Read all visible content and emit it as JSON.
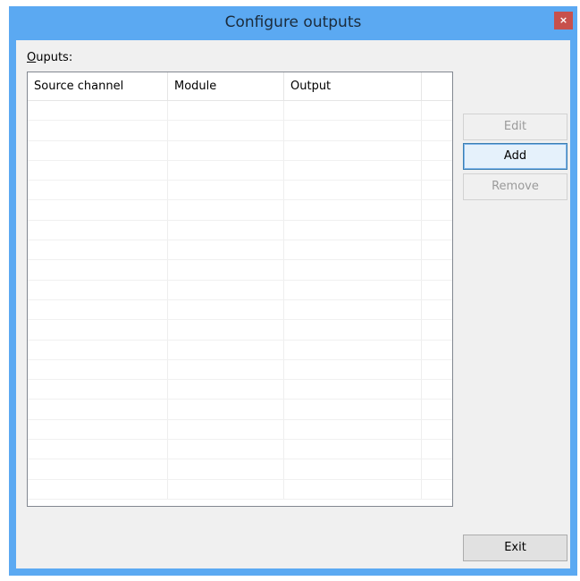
{
  "window": {
    "title": "Configure outputs",
    "close_glyph": "×"
  },
  "list": {
    "label_mnemonic": "O",
    "label_rest": "uputs:",
    "columns": [
      "Source channel",
      "Module",
      "Output",
      ""
    ],
    "rows": []
  },
  "buttons": {
    "edit": "Edit",
    "add": "Add",
    "remove": "Remove",
    "exit": "Exit"
  },
  "colors": {
    "titlebar": "#5ba9f2",
    "close_button": "#c7504c",
    "client": "#f0f0f0"
  }
}
